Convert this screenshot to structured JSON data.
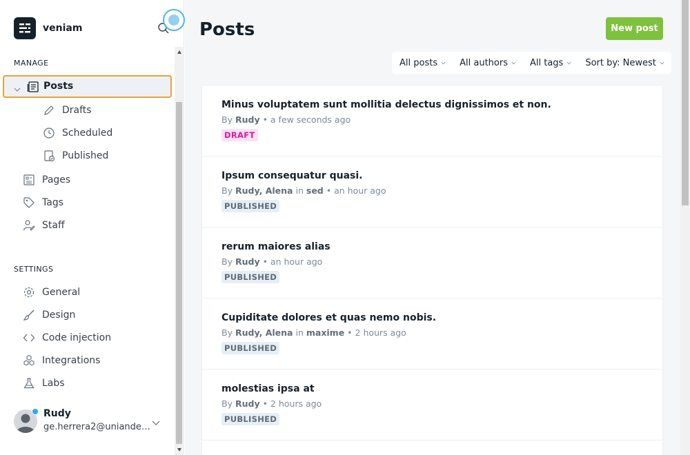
{
  "brand": {
    "name": "veniam"
  },
  "sidebar": {
    "manage_title": "MANAGE",
    "settings_title": "SETTINGS",
    "active": {
      "label": "Posts"
    },
    "sub_items": [
      {
        "label": "Drafts",
        "icon": "pencil-icon"
      },
      {
        "label": "Scheduled",
        "icon": "clock-icon"
      },
      {
        "label": "Published",
        "icon": "published-icon"
      }
    ],
    "manage_items": [
      {
        "label": "Pages",
        "icon": "pages-icon"
      },
      {
        "label": "Tags",
        "icon": "tag-icon"
      },
      {
        "label": "Staff",
        "icon": "staff-icon"
      }
    ],
    "settings_items": [
      {
        "label": "General",
        "icon": "gear-icon"
      },
      {
        "label": "Design",
        "icon": "brush-icon"
      },
      {
        "label": "Code injection",
        "icon": "code-icon"
      },
      {
        "label": "Integrations",
        "icon": "integrations-icon"
      },
      {
        "label": "Labs",
        "icon": "flask-icon"
      }
    ]
  },
  "user": {
    "name": "Rudy",
    "email": "ge.herrera2@uniandes.edu.co"
  },
  "main": {
    "title": "Posts",
    "new_post_label": "New post",
    "filters": {
      "type": "All posts",
      "authors": "All authors",
      "tags": "All tags",
      "sort": "Sort by: Newest"
    },
    "posts": [
      {
        "title": "Minus voluptatem sunt mollitia delectus dignissimos et non.",
        "by": "By",
        "authors": "Rudy",
        "in": "",
        "tag": "",
        "time": "a few seconds ago",
        "status": "DRAFT"
      },
      {
        "title": "Ipsum consequatur quasi.",
        "by": "By",
        "authors": "Rudy, Alena",
        "in": "in",
        "tag": "sed",
        "time": "an hour ago",
        "status": "PUBLISHED"
      },
      {
        "title": "rerum maiores alias",
        "by": "By",
        "authors": "Rudy",
        "in": "",
        "tag": "",
        "time": "an hour ago",
        "status": "PUBLISHED"
      },
      {
        "title": "Cupiditate dolores et quas nemo nobis.",
        "by": "By",
        "authors": "Rudy, Alena",
        "in": "in",
        "tag": "maxime",
        "time": "2 hours ago",
        "status": "PUBLISHED"
      },
      {
        "title": "molestias ipsa at",
        "by": "By",
        "authors": "Rudy",
        "in": "",
        "tag": "",
        "time": "2 hours ago",
        "status": "PUBLISHED"
      }
    ]
  },
  "colors": {
    "accent": "#7ec13d",
    "focus_outline": "#e6a33b",
    "draft": "#d21ba5"
  }
}
